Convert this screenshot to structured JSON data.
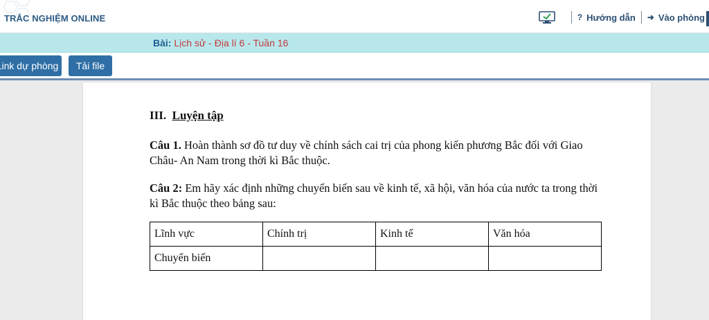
{
  "header": {
    "brand": "TRẮC NGHIỆM ONLINE",
    "nav": [
      {
        "label": "Hướng dẫn",
        "icon": "question-icon"
      },
      {
        "label": "Vào phòng",
        "icon": "sign-in-icon"
      }
    ]
  },
  "lesson": {
    "prefix": "Bài:",
    "title": "Lịch sử - Địa lí 6 - Tuần 16"
  },
  "toolbar": {
    "backup_label": "Link dự phòng",
    "download_label": "Tải file"
  },
  "document": {
    "heading_num": "III.",
    "heading_text": "Luyện tập",
    "q1_label": "Câu 1.",
    "q1_text": "Hoàn thành sơ đồ tư duy về chính sách cai trị của phong kiến phương Bắc đối với Giao Châu- An Nam trong thời kì Bắc thuộc.",
    "q2_label": "Câu 2:",
    "q2_text": "Em hãy xác định những chuyển biến sau về kinh tế, xã hội, văn hóa của nước ta trong thời kì Bắc thuộc theo bảng sau:",
    "table": {
      "headers": [
        "Lĩnh vực",
        "Chính trị",
        "Kinh tế",
        "Văn hóa"
      ],
      "rows": [
        [
          "Chuyển biến",
          "",
          "",
          ""
        ]
      ]
    }
  },
  "colors": {
    "brand": "#2c5a85",
    "lesson_bar": "#b8e8ec",
    "button": "#2f6fa6",
    "lesson_title": "#c13a3a"
  }
}
